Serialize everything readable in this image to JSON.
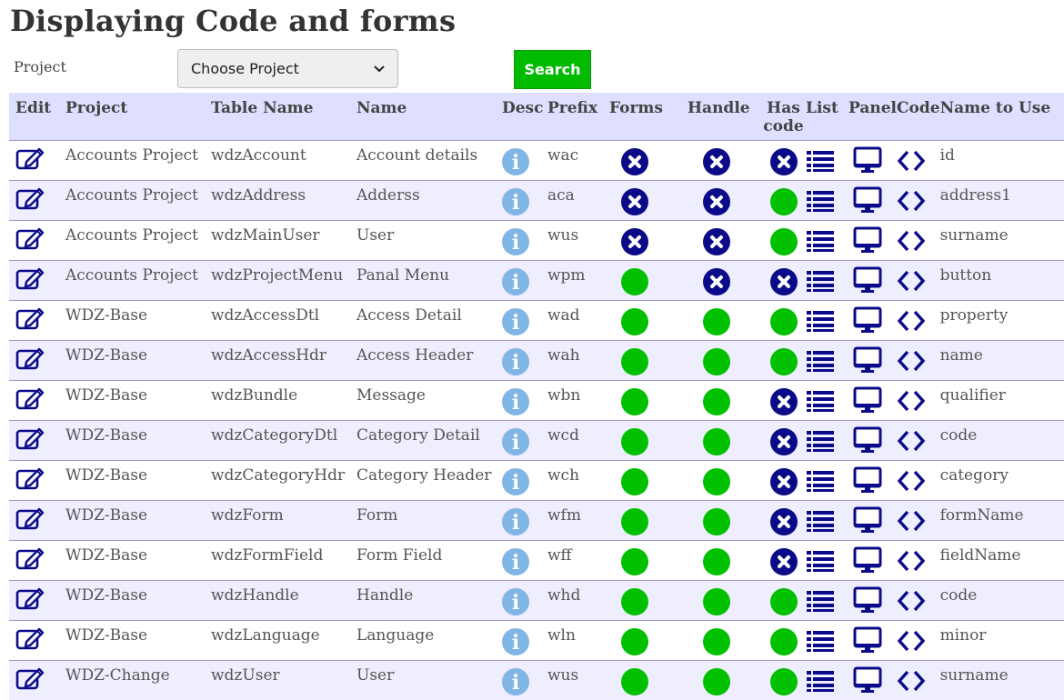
{
  "page": {
    "title": "Displaying Code and forms"
  },
  "filter": {
    "project_label": "Project",
    "project_select": "Choose Project",
    "search_label": "Search"
  },
  "colors": {
    "ok": "#00c000",
    "no": "#0b0b8a",
    "info": "#7fb6e6",
    "header_bg": "#dfdfff",
    "search": "#00bb00"
  },
  "icons": {
    "edit": "edit-icon",
    "info": "info-icon",
    "ok": "check-circle-icon",
    "no": "x-circle-icon",
    "list": "list-icon",
    "panel": "monitor-icon",
    "code": "code-icon"
  },
  "table": {
    "headers": {
      "edit": "Edit",
      "project": "Project",
      "table_name": "Table Name",
      "name": "Name",
      "desc": "Desc",
      "prefix": "Prefix",
      "forms": "Forms",
      "handle": "Handle",
      "has_code_1": "Has",
      "has_code_2": "code",
      "list": "List",
      "panel": "Panel",
      "code": "Code",
      "name_to_use": "Name to Use"
    },
    "rows": [
      {
        "project": "Accounts Project",
        "table": "wdzAccount",
        "name": "Account details",
        "prefix": "wac",
        "forms": false,
        "handle": false,
        "has_code": false,
        "name_to_use": "id"
      },
      {
        "project": "Accounts Project",
        "table": "wdzAddress",
        "name": "Adderss",
        "prefix": "aca",
        "forms": false,
        "handle": false,
        "has_code": true,
        "name_to_use": "address1"
      },
      {
        "project": "Accounts Project",
        "table": "wdzMainUser",
        "name": "User",
        "prefix": "wus",
        "forms": false,
        "handle": false,
        "has_code": true,
        "name_to_use": "surname"
      },
      {
        "project": "Accounts Project",
        "table": "wdzProjectMenu",
        "name": "Panal Menu",
        "prefix": "wpm",
        "forms": true,
        "handle": false,
        "has_code": false,
        "name_to_use": "button"
      },
      {
        "project": "WDZ-Base",
        "table": "wdzAccessDtl",
        "name": "Access Detail",
        "prefix": "wad",
        "forms": true,
        "handle": true,
        "has_code": true,
        "name_to_use": "property"
      },
      {
        "project": "WDZ-Base",
        "table": "wdzAccessHdr",
        "name": "Access Header",
        "prefix": "wah",
        "forms": true,
        "handle": true,
        "has_code": true,
        "name_to_use": "name"
      },
      {
        "project": "WDZ-Base",
        "table": "wdzBundle",
        "name": "Message",
        "prefix": "wbn",
        "forms": true,
        "handle": true,
        "has_code": false,
        "name_to_use": "qualifier"
      },
      {
        "project": "WDZ-Base",
        "table": "wdzCategoryDtl",
        "name": "Category Detail",
        "prefix": "wcd",
        "forms": true,
        "handle": true,
        "has_code": false,
        "name_to_use": "code"
      },
      {
        "project": "WDZ-Base",
        "table": "wdzCategoryHdr",
        "name": "Category Header",
        "prefix": "wch",
        "forms": true,
        "handle": true,
        "has_code": false,
        "name_to_use": "category"
      },
      {
        "project": "WDZ-Base",
        "table": "wdzForm",
        "name": "Form",
        "prefix": "wfm",
        "forms": true,
        "handle": true,
        "has_code": false,
        "name_to_use": "formName"
      },
      {
        "project": "WDZ-Base",
        "table": "wdzFormField",
        "name": "Form Field",
        "prefix": "wff",
        "forms": true,
        "handle": true,
        "has_code": false,
        "name_to_use": "fieldName"
      },
      {
        "project": "WDZ-Base",
        "table": "wdzHandle",
        "name": "Handle",
        "prefix": "whd",
        "forms": true,
        "handle": true,
        "has_code": true,
        "name_to_use": "code"
      },
      {
        "project": "WDZ-Base",
        "table": "wdzLanguage",
        "name": "Language",
        "prefix": "wln",
        "forms": true,
        "handle": true,
        "has_code": true,
        "name_to_use": "minor"
      },
      {
        "project": "WDZ-Change",
        "table": "wdzUser",
        "name": "User",
        "prefix": "wus",
        "forms": true,
        "handle": true,
        "has_code": true,
        "name_to_use": "surname"
      }
    ]
  }
}
